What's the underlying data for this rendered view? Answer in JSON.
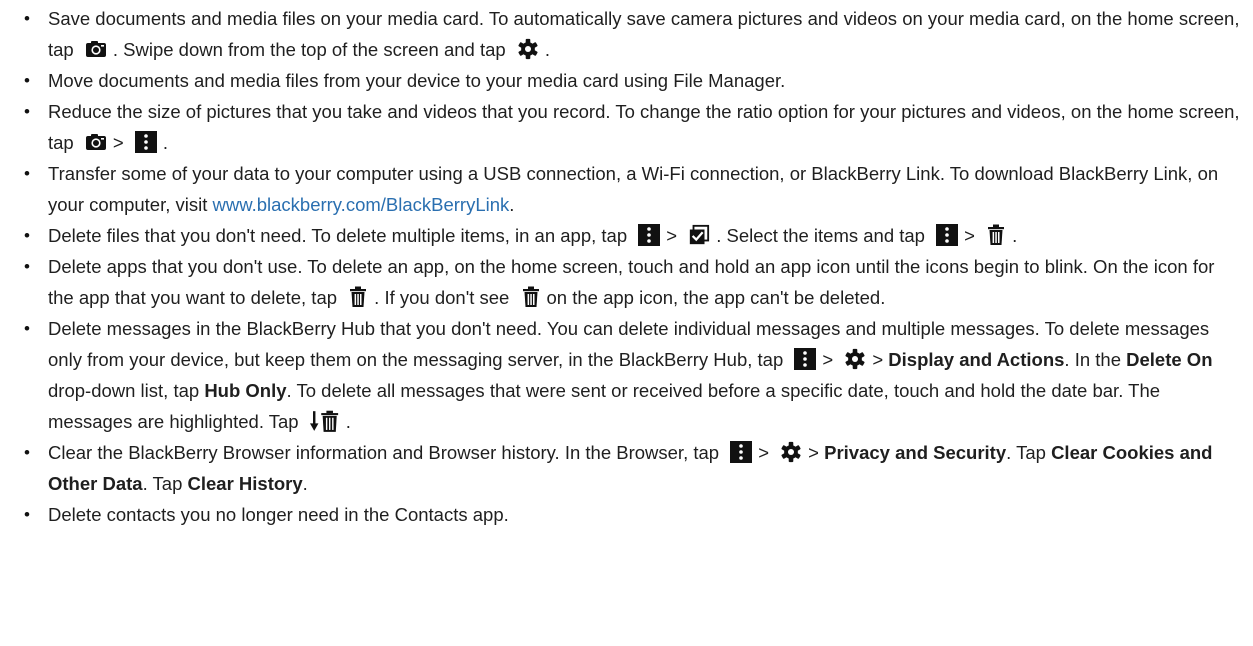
{
  "bullet": "•",
  "gt": ">",
  "items": [
    {
      "a": "Save documents and media files on your media card. To automatically save camera pictures and videos on your media card, on the home screen, tap",
      "b": ". Swipe down from the top of the screen and tap",
      "c": "."
    },
    {
      "a": "Move documents and media files from your device to your media card using File Manager."
    },
    {
      "a": "Reduce the size of pictures that you take and videos that you record. To change the ratio option for your pictures and videos, on the home screen, tap",
      "c": "."
    },
    {
      "a": "Transfer some of your data to your computer using a USB connection, a Wi-Fi connection, or BlackBerry Link. To download BlackBerry Link, on your computer, visit",
      "link": "www.blackberry.com/BlackBerryLink",
      "c": "."
    },
    {
      "a": "Delete files that you don't need. To delete multiple items, in an app, tap",
      "b": ". Select the items and tap",
      "c": "."
    },
    {
      "a": "Delete apps that you don't use. To delete an app, on the home screen, touch and hold an app icon until the icons begin to blink. On the icon for the app that you want to delete, tap",
      "b": ". If you don't see",
      "c": "on the app icon, the app can't be deleted."
    },
    {
      "a": "Delete messages in the BlackBerry Hub that you don't need. You can delete individual messages and multiple messages. To delete messages only from your device, but keep them on the messaging server, in the BlackBerry Hub, tap",
      "b1": "Display and Actions",
      "b": ". In the",
      "b2": "Delete On",
      "c": "drop-down list, tap",
      "b3": "Hub Only",
      "d": ". To delete all messages that were sent or received before a specific date, touch and hold the date bar. The messages are highlighted. Tap",
      "e": "."
    },
    {
      "a": "Clear the BlackBerry Browser information and Browser history. In the Browser, tap",
      "b1": "Privacy and Security",
      "b": ". Tap",
      "b2": "Clear Cookies and Other Data",
      "c": ". Tap",
      "b3": "Clear History",
      "d": "."
    },
    {
      "a": "Delete contacts you no longer need in the Contacts app."
    }
  ],
  "icons": {
    "camera": "camera-icon",
    "settings": "gear-icon",
    "menu": "more-menu-icon",
    "select": "select-items-icon",
    "delete": "trash-icon",
    "delete_prior": "delete-prior-icon"
  }
}
